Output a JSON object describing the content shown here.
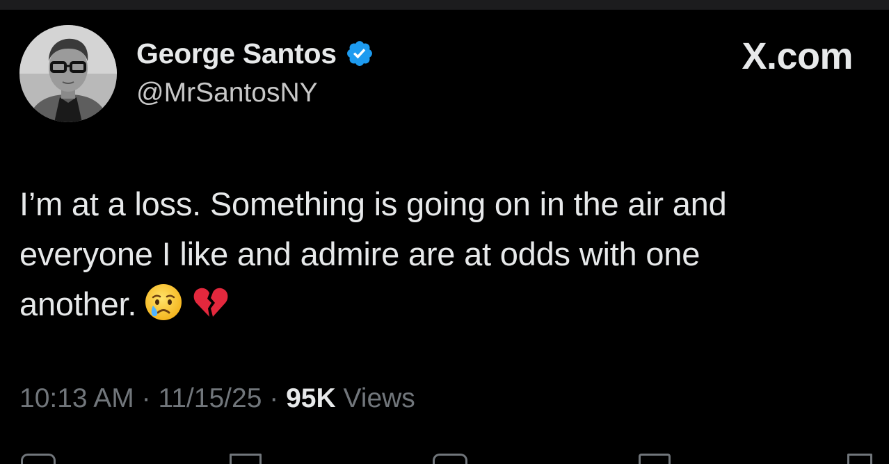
{
  "site_mark": "X.com",
  "author": {
    "display_name": "George Santos",
    "handle": "@MrSantosNY",
    "verified": true
  },
  "tweet": {
    "line1": "I’m at a loss. Something is going on in the air and",
    "line2": "everyone I like and admire are at odds with one",
    "line3": "another.",
    "emojis": [
      "crying-face",
      "broken-heart"
    ]
  },
  "meta": {
    "time": "10:13 AM",
    "separator": "·",
    "date": "11/15/25",
    "views_count": "95K",
    "views_label": "Views"
  },
  "colors": {
    "background": "#000000",
    "text_primary": "#e7e9ea",
    "text_secondary": "#71767b",
    "verified_badge": "#1d9bf0"
  },
  "icons": {
    "verified": "verified-badge-icon",
    "reply": "reply-icon",
    "repost": "repost-icon",
    "like": "like-icon",
    "bookmark": "bookmark-icon",
    "share": "share-icon"
  }
}
